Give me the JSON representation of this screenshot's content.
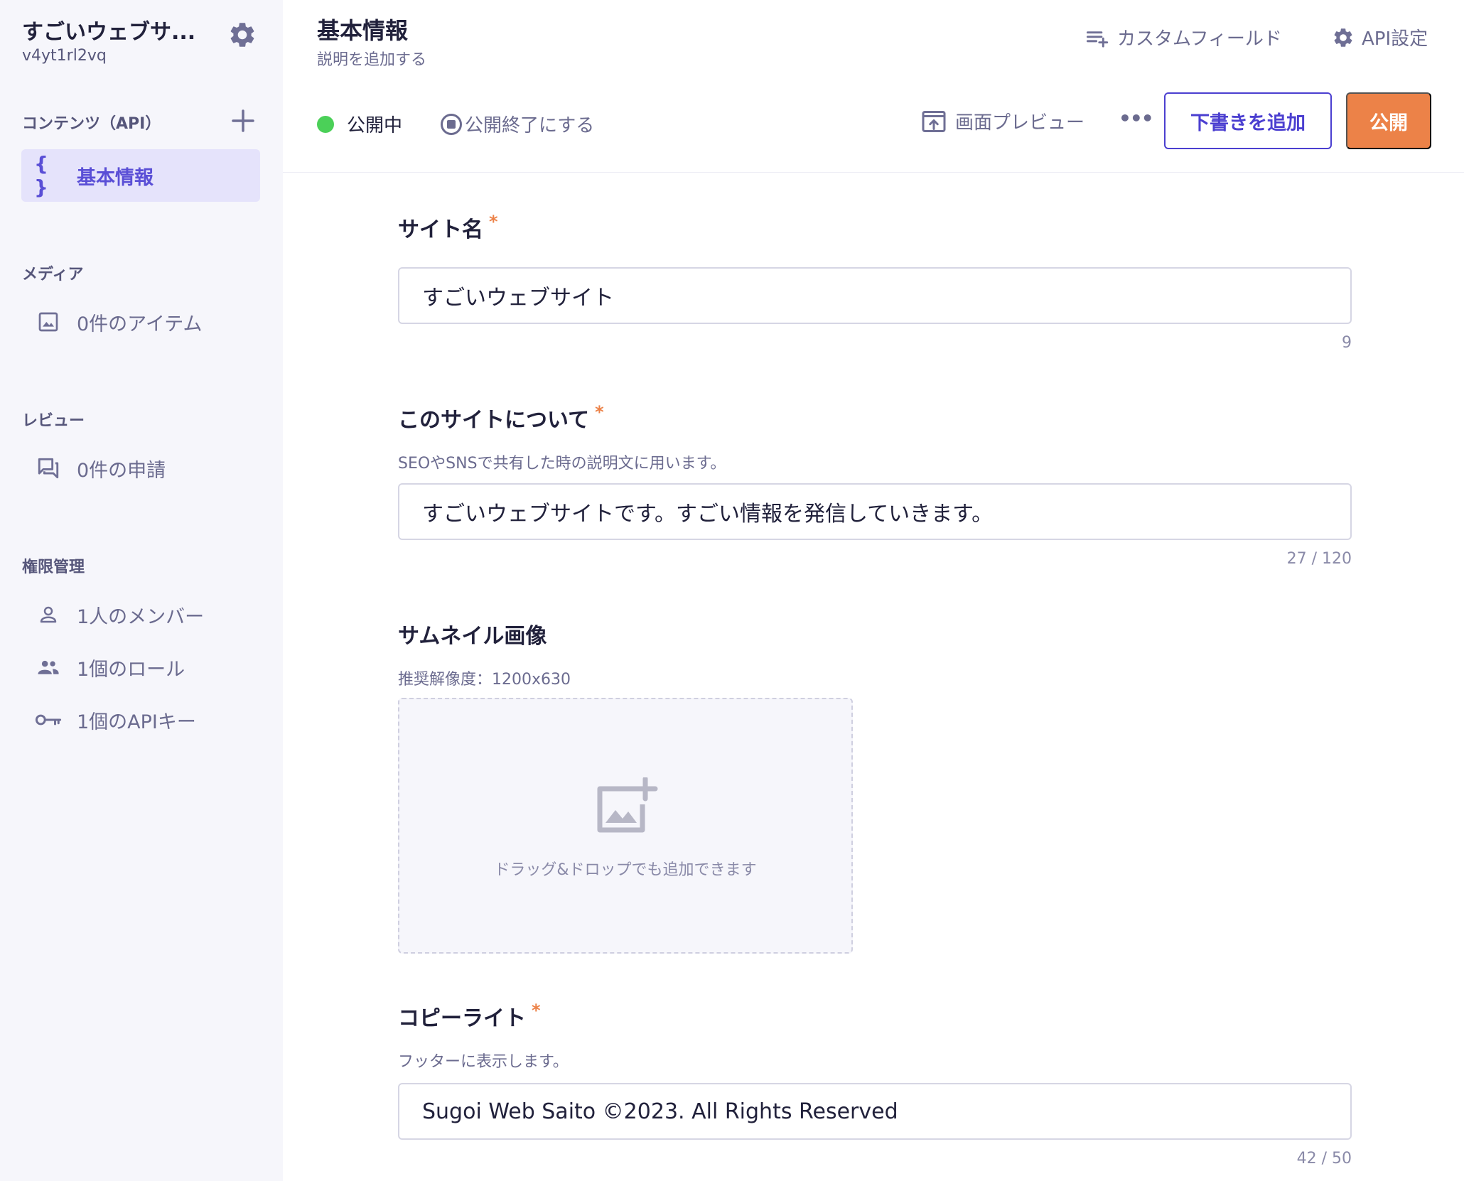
{
  "sidebar": {
    "service_name": "すごいウェブサ...",
    "service_id": "v4yt1rl2vq",
    "content_section": "コンテンツ（API）",
    "content_items": [
      {
        "icon": "braces-icon",
        "label": "基本情報"
      }
    ],
    "media_section": "メディア",
    "media_item": "0件のアイテム",
    "review_section": "レビュー",
    "review_item": "0件の申請",
    "permission_section": "権限管理",
    "permission_items": [
      {
        "icon": "person-icon",
        "label": "1人のメンバー"
      },
      {
        "icon": "group-icon",
        "label": "1個のロール"
      },
      {
        "icon": "key-icon",
        "label": "1個のAPIキー"
      }
    ]
  },
  "header": {
    "title": "基本情報",
    "description": "説明を追加する",
    "custom_field": "カスタムフィールド",
    "api_settings": "API設定",
    "status": "公開中",
    "unpublish": "公開終了にする",
    "preview": "画面プレビュー",
    "more": "•••",
    "draft_button": "下書きを追加",
    "publish_button": "公開"
  },
  "colors": {
    "accent": "#4b3fd0",
    "publish": "#ec8248",
    "status_published": "#4bd058",
    "required": "#ec8248"
  },
  "form": {
    "site_name": {
      "label": "サイト名",
      "required_mark": "*",
      "value": "すごいウェブサイト",
      "counter": "9"
    },
    "about": {
      "label": "このサイトについて",
      "required_mark": "*",
      "description": "SEOやSNSで共有した時の説明文に用います。",
      "value": "すごいウェブサイトです。すごい情報を発信していきます。",
      "counter": "27 / 120"
    },
    "thumbnail": {
      "label": "サムネイル画像",
      "description": "推奨解像度：1200x630",
      "dropzone_text": "ドラッグ&ドロップでも追加できます"
    },
    "copyright": {
      "label": "コピーライト",
      "required_mark": "*",
      "description": "フッターに表示します。",
      "value": "Sugoi Web Saito ©2023. All Rights Reserved",
      "counter": "42 / 50"
    }
  }
}
